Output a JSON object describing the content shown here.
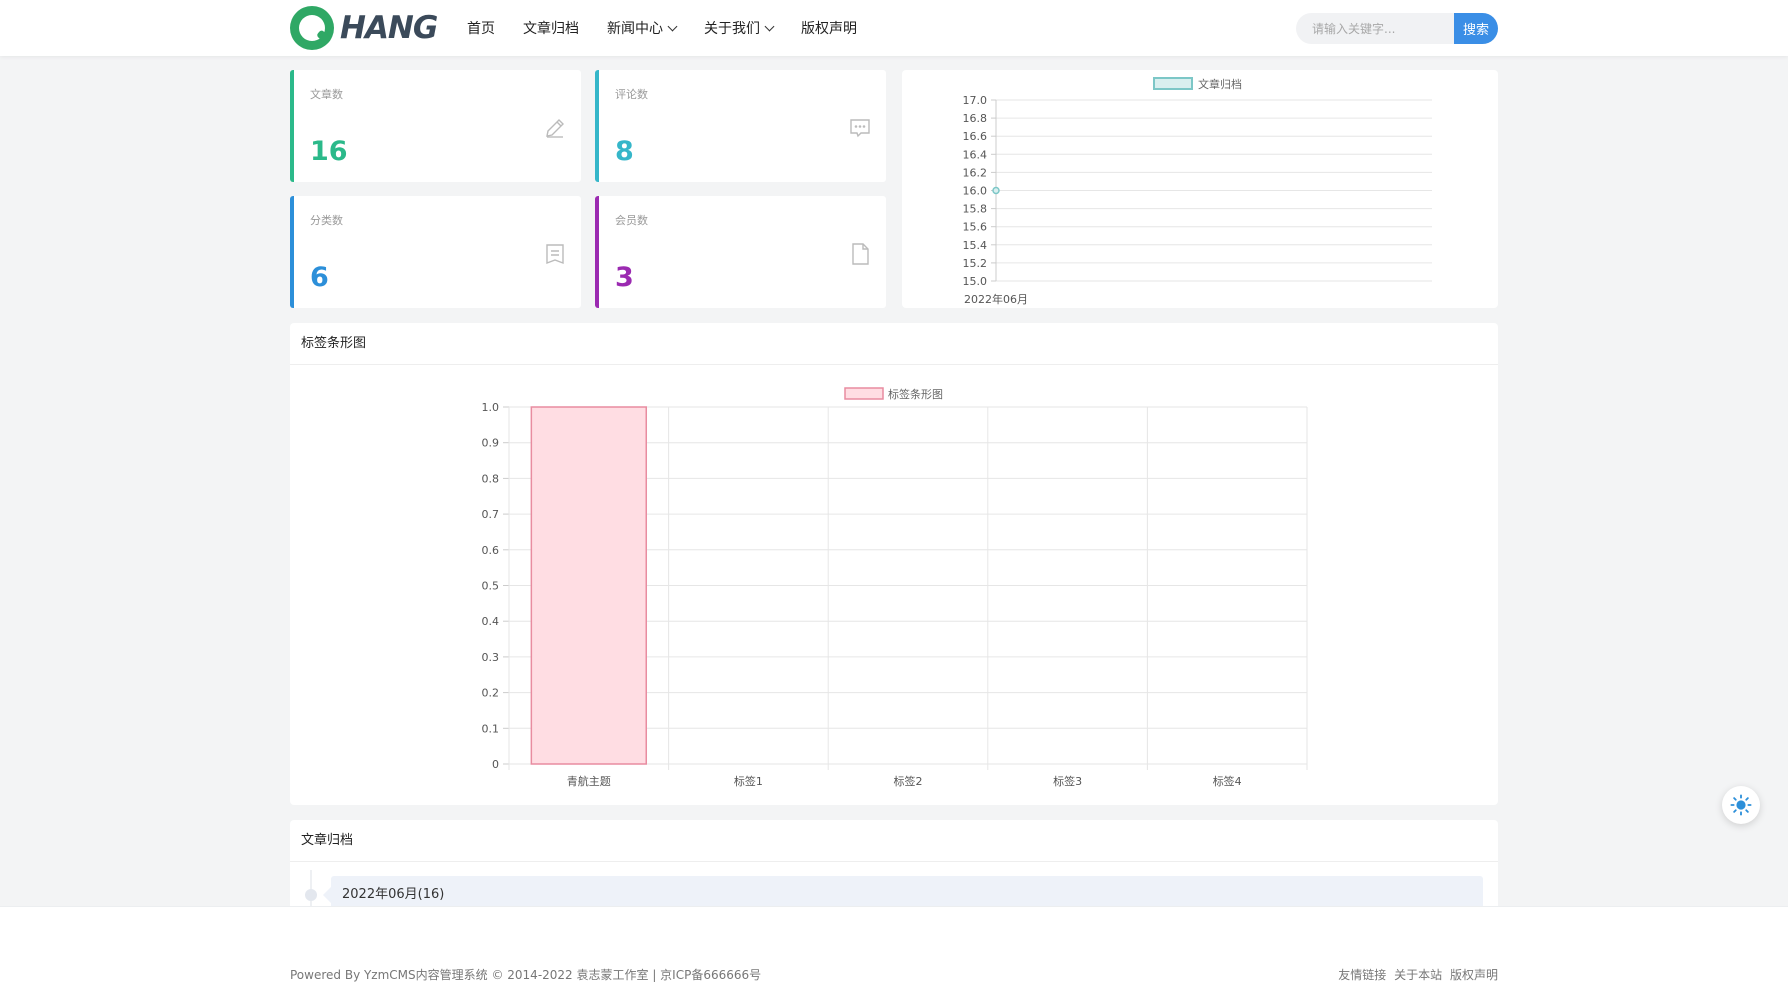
{
  "header": {
    "logo_text": "HANG",
    "nav": [
      {
        "label": "首页",
        "dropdown": false
      },
      {
        "label": "文章归档",
        "dropdown": false
      },
      {
        "label": "新闻中心",
        "dropdown": true
      },
      {
        "label": "关于我们",
        "dropdown": true
      },
      {
        "label": "版权声明",
        "dropdown": false
      }
    ],
    "search_placeholder": "请输入关键字...",
    "search_button": "搜索"
  },
  "stats": [
    {
      "label": "文章数",
      "value": "16",
      "color": "#2bb98a",
      "icon": "edit-icon"
    },
    {
      "label": "评论数",
      "value": "8",
      "color": "#35b6c9",
      "icon": "comment-icon"
    },
    {
      "label": "分类数",
      "value": "6",
      "color": "#2c8fd9",
      "icon": "list-icon"
    },
    {
      "label": "会员数",
      "value": "3",
      "color": "#9b2ab1",
      "icon": "file-icon"
    }
  ],
  "tag_panel_title": "标签条形图",
  "archive_panel_title": "文章归档",
  "archive_items": [
    "2022年06月(16)"
  ],
  "chart_data": [
    {
      "type": "line",
      "legend": "文章归档",
      "categories": [
        "2022年06月"
      ],
      "series": [
        {
          "name": "文章归档",
          "values": [
            16
          ]
        }
      ],
      "ylim": [
        15.0,
        17.0
      ],
      "yticks": [
        "17.0",
        "16.8",
        "16.6",
        "16.4",
        "16.2",
        "16.0",
        "15.8",
        "15.6",
        "15.4",
        "15.2",
        "15.0"
      ],
      "legend_position": "top",
      "grid": true,
      "color": "#7cc7c7"
    },
    {
      "type": "bar",
      "legend": "标签条形图",
      "categories": [
        "青航主题",
        "标签1",
        "标签2",
        "标签3",
        "标签4"
      ],
      "series": [
        {
          "name": "标签条形图",
          "values": [
            1,
            0,
            0,
            0,
            0
          ]
        }
      ],
      "ylim": [
        0,
        1.0
      ],
      "yticks": [
        "1.0",
        "0.9",
        "0.8",
        "0.7",
        "0.6",
        "0.5",
        "0.4",
        "0.3",
        "0.2",
        "0.1",
        "0"
      ],
      "legend_position": "top",
      "grid": true,
      "color": "#ffdde3",
      "border_color": "#e88ca0"
    }
  ],
  "footer": {
    "left": "Powered By YzmCMS内容管理系统 © 2014-2022 袁志蒙工作室 |  京ICP备666666号",
    "links": [
      "友情链接",
      "关于本站",
      "版权声明"
    ]
  }
}
